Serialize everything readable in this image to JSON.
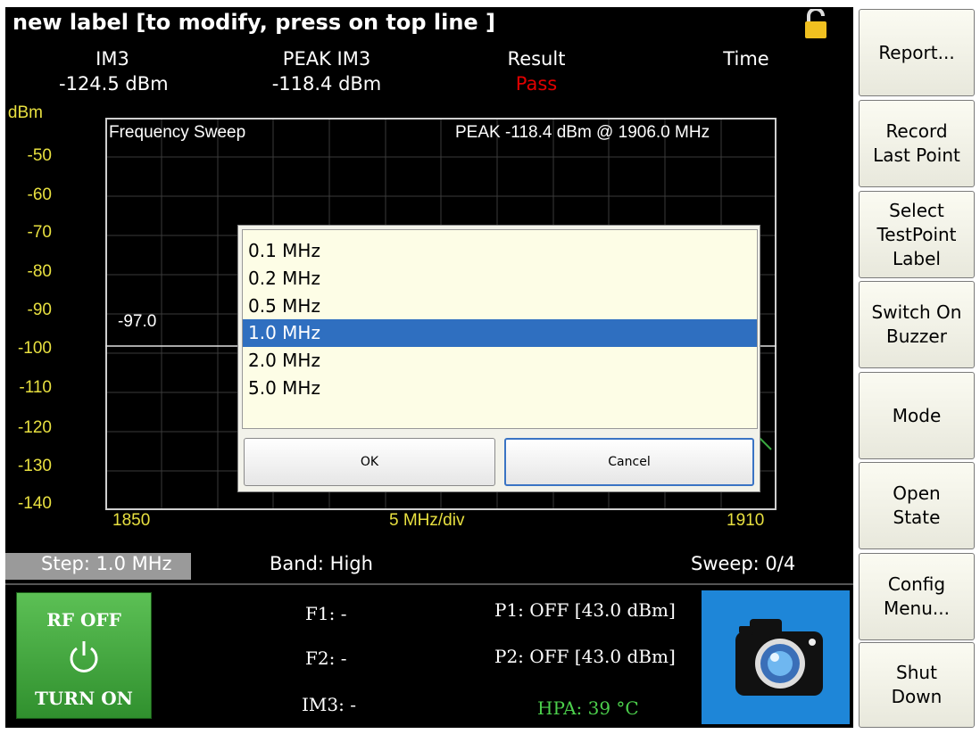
{
  "title": "new label [to modify, press on top line ]",
  "header": {
    "im3_label": "IM3",
    "im3_value": "-124.5 dBm",
    "peak_label": "PEAK IM3",
    "peak_value": "-118.4 dBm",
    "result_label": "Result",
    "result_value": "Pass",
    "time_label": "Time"
  },
  "plot": {
    "y_unit": "dBm",
    "y_ticks": [
      "-50",
      "-60",
      "-70",
      "-80",
      "-90",
      "-100",
      "-110",
      "-120",
      "-130",
      "-140"
    ],
    "title": "Frequency Sweep",
    "peak_text": "PEAK -118.4 dBm @ 1906.0 MHz",
    "marker_value": "-97.0",
    "x_start": "1850",
    "x_div": "5 MHz/div",
    "x_end": "1910"
  },
  "status": {
    "step": "Step: 1.0 MHz",
    "band": "Band: High",
    "sweep": "Sweep: 0/4"
  },
  "rf": {
    "state": "RF OFF",
    "action": "TURN ON"
  },
  "info": {
    "f1": "F1: -",
    "f2": "F2: -",
    "im3": "IM3: -",
    "p1": "P1: OFF [43.0 dBm]",
    "p2": "P2: OFF [43.0 dBm]",
    "hpa": "HPA: 39 °C"
  },
  "dialog": {
    "options": [
      "0.1 MHz",
      "0.2 MHz",
      "0.5 MHz",
      "1.0 MHz",
      "2.0 MHz",
      "5.0 MHz"
    ],
    "selected_index": 3,
    "ok": "OK",
    "cancel": "Cancel"
  },
  "sidebar": [
    {
      "label": "Report..."
    },
    {
      "label": "Record\nLast Point"
    },
    {
      "label": "Select\nTestPoint\nLabel"
    },
    {
      "label": "Switch On\nBuzzer"
    },
    {
      "label": "Mode"
    },
    {
      "label": "Open\nState"
    },
    {
      "label": "Config\nMenu..."
    },
    {
      "label": "Shut\nDown"
    }
  ],
  "colors": {
    "selection": "#2f6fc0",
    "axis_text": "#e8e040",
    "pass": "#e00000",
    "rf_button": "#3fa83c",
    "camera": "#1e86d8"
  }
}
